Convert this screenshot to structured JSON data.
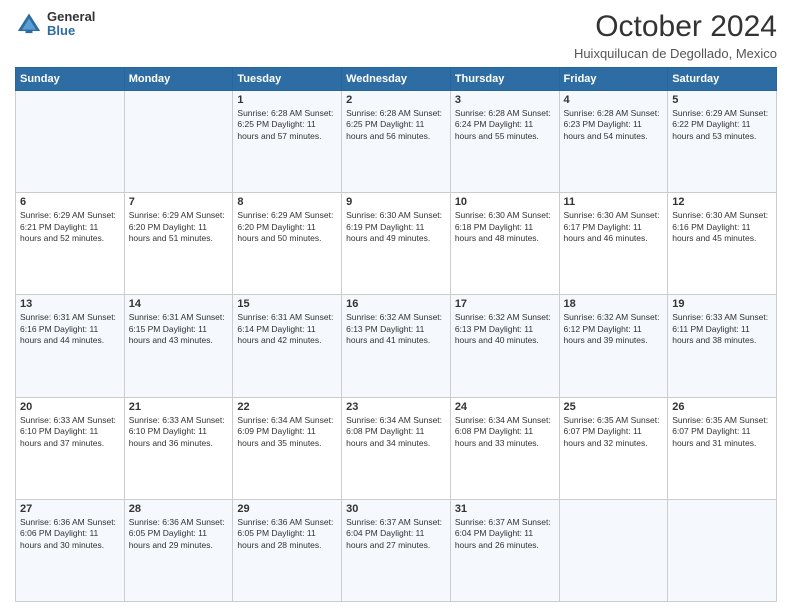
{
  "logo": {
    "general": "General",
    "blue": "Blue"
  },
  "title": "October 2024",
  "location": "Huixquilucan de Degollado, Mexico",
  "days_header": [
    "Sunday",
    "Monday",
    "Tuesday",
    "Wednesday",
    "Thursday",
    "Friday",
    "Saturday"
  ],
  "weeks": [
    [
      {
        "day": "",
        "info": ""
      },
      {
        "day": "",
        "info": ""
      },
      {
        "day": "1",
        "info": "Sunrise: 6:28 AM\nSunset: 6:25 PM\nDaylight: 11 hours\nand 57 minutes."
      },
      {
        "day": "2",
        "info": "Sunrise: 6:28 AM\nSunset: 6:25 PM\nDaylight: 11 hours\nand 56 minutes."
      },
      {
        "day": "3",
        "info": "Sunrise: 6:28 AM\nSunset: 6:24 PM\nDaylight: 11 hours\nand 55 minutes."
      },
      {
        "day": "4",
        "info": "Sunrise: 6:28 AM\nSunset: 6:23 PM\nDaylight: 11 hours\nand 54 minutes."
      },
      {
        "day": "5",
        "info": "Sunrise: 6:29 AM\nSunset: 6:22 PM\nDaylight: 11 hours\nand 53 minutes."
      }
    ],
    [
      {
        "day": "6",
        "info": "Sunrise: 6:29 AM\nSunset: 6:21 PM\nDaylight: 11 hours\nand 52 minutes."
      },
      {
        "day": "7",
        "info": "Sunrise: 6:29 AM\nSunset: 6:20 PM\nDaylight: 11 hours\nand 51 minutes."
      },
      {
        "day": "8",
        "info": "Sunrise: 6:29 AM\nSunset: 6:20 PM\nDaylight: 11 hours\nand 50 minutes."
      },
      {
        "day": "9",
        "info": "Sunrise: 6:30 AM\nSunset: 6:19 PM\nDaylight: 11 hours\nand 49 minutes."
      },
      {
        "day": "10",
        "info": "Sunrise: 6:30 AM\nSunset: 6:18 PM\nDaylight: 11 hours\nand 48 minutes."
      },
      {
        "day": "11",
        "info": "Sunrise: 6:30 AM\nSunset: 6:17 PM\nDaylight: 11 hours\nand 46 minutes."
      },
      {
        "day": "12",
        "info": "Sunrise: 6:30 AM\nSunset: 6:16 PM\nDaylight: 11 hours\nand 45 minutes."
      }
    ],
    [
      {
        "day": "13",
        "info": "Sunrise: 6:31 AM\nSunset: 6:16 PM\nDaylight: 11 hours\nand 44 minutes."
      },
      {
        "day": "14",
        "info": "Sunrise: 6:31 AM\nSunset: 6:15 PM\nDaylight: 11 hours\nand 43 minutes."
      },
      {
        "day": "15",
        "info": "Sunrise: 6:31 AM\nSunset: 6:14 PM\nDaylight: 11 hours\nand 42 minutes."
      },
      {
        "day": "16",
        "info": "Sunrise: 6:32 AM\nSunset: 6:13 PM\nDaylight: 11 hours\nand 41 minutes."
      },
      {
        "day": "17",
        "info": "Sunrise: 6:32 AM\nSunset: 6:13 PM\nDaylight: 11 hours\nand 40 minutes."
      },
      {
        "day": "18",
        "info": "Sunrise: 6:32 AM\nSunset: 6:12 PM\nDaylight: 11 hours\nand 39 minutes."
      },
      {
        "day": "19",
        "info": "Sunrise: 6:33 AM\nSunset: 6:11 PM\nDaylight: 11 hours\nand 38 minutes."
      }
    ],
    [
      {
        "day": "20",
        "info": "Sunrise: 6:33 AM\nSunset: 6:10 PM\nDaylight: 11 hours\nand 37 minutes."
      },
      {
        "day": "21",
        "info": "Sunrise: 6:33 AM\nSunset: 6:10 PM\nDaylight: 11 hours\nand 36 minutes."
      },
      {
        "day": "22",
        "info": "Sunrise: 6:34 AM\nSunset: 6:09 PM\nDaylight: 11 hours\nand 35 minutes."
      },
      {
        "day": "23",
        "info": "Sunrise: 6:34 AM\nSunset: 6:08 PM\nDaylight: 11 hours\nand 34 minutes."
      },
      {
        "day": "24",
        "info": "Sunrise: 6:34 AM\nSunset: 6:08 PM\nDaylight: 11 hours\nand 33 minutes."
      },
      {
        "day": "25",
        "info": "Sunrise: 6:35 AM\nSunset: 6:07 PM\nDaylight: 11 hours\nand 32 minutes."
      },
      {
        "day": "26",
        "info": "Sunrise: 6:35 AM\nSunset: 6:07 PM\nDaylight: 11 hours\nand 31 minutes."
      }
    ],
    [
      {
        "day": "27",
        "info": "Sunrise: 6:36 AM\nSunset: 6:06 PM\nDaylight: 11 hours\nand 30 minutes."
      },
      {
        "day": "28",
        "info": "Sunrise: 6:36 AM\nSunset: 6:05 PM\nDaylight: 11 hours\nand 29 minutes."
      },
      {
        "day": "29",
        "info": "Sunrise: 6:36 AM\nSunset: 6:05 PM\nDaylight: 11 hours\nand 28 minutes."
      },
      {
        "day": "30",
        "info": "Sunrise: 6:37 AM\nSunset: 6:04 PM\nDaylight: 11 hours\nand 27 minutes."
      },
      {
        "day": "31",
        "info": "Sunrise: 6:37 AM\nSunset: 6:04 PM\nDaylight: 11 hours\nand 26 minutes."
      },
      {
        "day": "",
        "info": ""
      },
      {
        "day": "",
        "info": ""
      }
    ]
  ]
}
